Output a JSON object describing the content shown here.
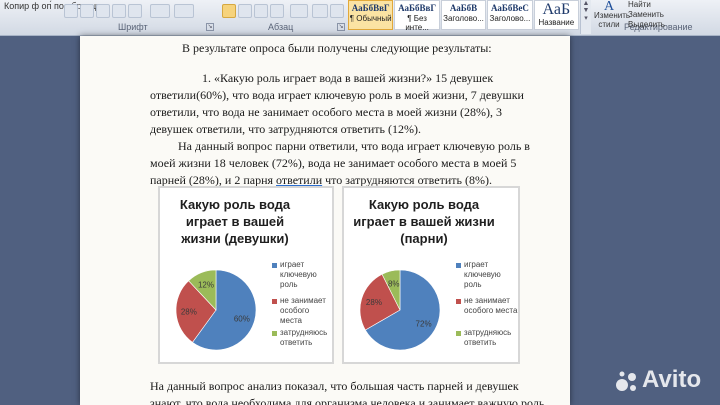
{
  "ribbon": {
    "row_left": "Копир ф оп́ по обраэцу",
    "font_group_label": "Шрифт",
    "paragraph_group_label": "Абзац",
    "styles_group_label": "Стили",
    "editing_group_label": "Редактирование",
    "styles": [
      {
        "sample": "АаБбВвГ",
        "name": "¶ Обычный",
        "selected": true,
        "big": false
      },
      {
        "sample": "АаБбВвГ",
        "name": "¶ Без инте...",
        "selected": false,
        "big": false
      },
      {
        "sample": "АаБбВ",
        "name": "Заголово...",
        "selected": false,
        "big": false
      },
      {
        "sample": "АаБбВеС",
        "name": "Заголово...",
        "selected": false,
        "big": false
      },
      {
        "sample": "АаБ",
        "name": "Название",
        "selected": false,
        "big": true
      }
    ],
    "change_styles_label": "Изменить стили",
    "change_styles_icon": "A",
    "editing": [
      "Найти",
      "Заменить",
      "Выделить"
    ]
  },
  "document": {
    "line1": "В результате опроса были получены следующие результаты:",
    "para1_l1": "1. «Какую роль играет вода в вашей жизни?» 15 девушек",
    "para1_l2": "ответили(60%), что вода играет ключевую роль в моей жизни, 7 девушки",
    "para1_l3": "ответили, что вода не занимает особого места в моей  жизни (28%), 3",
    "para1_l4": "девушек ответили, что затрудняются ответить (12%).",
    "para2_l1": "На данный вопрос парни ответили, что вода играет ключевую роль в",
    "para2_l2": "моей жизни 18 человек (72%), вода не занимает особого места в моей 5",
    "para2_l3_a": "парней (28%), и 2 парня ",
    "para2_l3_u": "ответили",
    "para2_l3_b": " что затрудняются ответить (8%).",
    "bottom_l1": "На данный вопрос анализ показал, что большая часть парней и девушек",
    "bottom_l2": "знают, что вода необходима для организма человека и занимает важную роль"
  },
  "colors": {
    "blue": "#4f81bd",
    "red": "#c0504d",
    "green": "#9bbb59"
  },
  "chart_data": [
    {
      "type": "pie",
      "title_lines": [
        "Какую роль вода",
        "играет в вашей",
        "жизни (девушки)"
      ],
      "categories": [
        "играет ключевую роль",
        "не занимает особого места",
        "затрудняюсь ответить"
      ],
      "values": [
        60,
        28,
        12
      ],
      "data_labels": [
        "60%",
        "28%",
        "12%"
      ],
      "legend": [
        [
          "играет",
          "ключевую",
          "роль"
        ],
        [
          "не занимает",
          "особого места"
        ],
        [
          "затрудняюсь",
          "ответить"
        ]
      ],
      "legend_position": "right"
    },
    {
      "type": "pie",
      "title_lines": [
        "Какую роль вода",
        "играет в вашей жизни",
        "(парни)"
      ],
      "categories": [
        "играет ключевую роль",
        "не занимает особого места",
        "затрудняюсь ответить"
      ],
      "values": [
        72,
        28,
        8
      ],
      "data_labels": [
        "72%",
        "28%",
        "8%"
      ],
      "legend": [
        [
          "играет",
          "ключевую",
          "роль"
        ],
        [
          "не занимает",
          "особого места"
        ],
        [
          "затрудняюсь",
          "ответить"
        ]
      ],
      "legend_position": "right"
    }
  ],
  "watermark": "Avito"
}
